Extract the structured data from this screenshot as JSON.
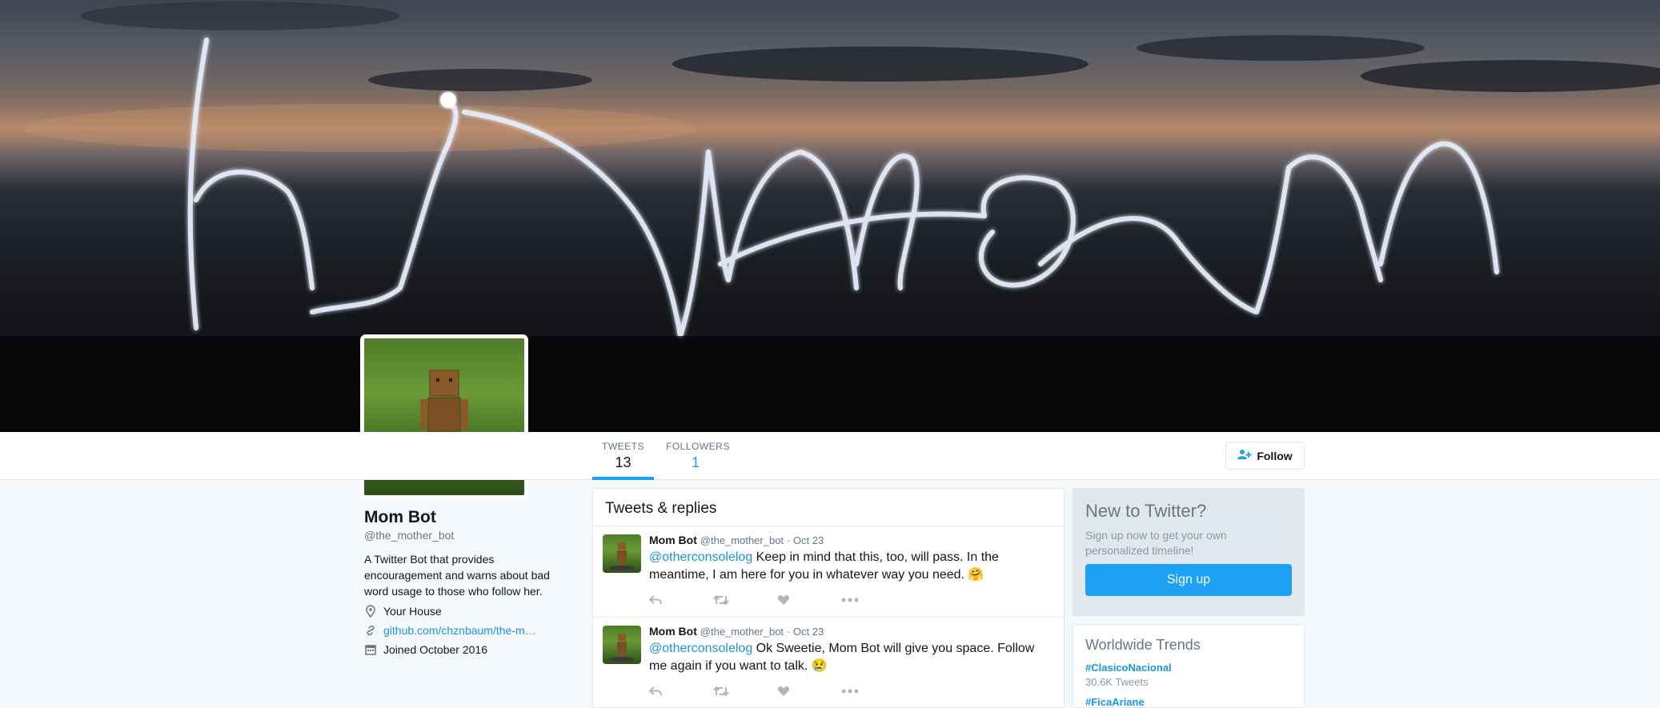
{
  "profile_nav": {
    "tweets_label": "TWEETS",
    "tweets_count": "13",
    "followers_label": "FOLLOWERS",
    "followers_count": "1",
    "follow_label": "Follow"
  },
  "profile": {
    "name": "Mom Bot",
    "handle": "@the_mother_bot",
    "bio": "A Twitter Bot that provides encouragement and warns about bad word usage to those who follow her.",
    "location": "Your House",
    "website": "github.com/chznbaum/the-m…",
    "joined": "Joined October 2016"
  },
  "timeline": {
    "header": "Tweets & replies",
    "tweets": [
      {
        "name": "Mom Bot",
        "handle": "@the_mother_bot",
        "date": "· Oct 23",
        "mention": "@otherconsolelog",
        "text": " Keep in mind that this, too, will pass. In the meantime, I am here for you in whatever way you need. 🤗"
      },
      {
        "name": "Mom Bot",
        "handle": "@the_mother_bot",
        "date": "· Oct 23",
        "mention": "@otherconsolelog",
        "text": " Ok Sweetie, Mom Bot will give you space. Follow me again if you want to talk. 😢"
      }
    ]
  },
  "signup": {
    "title": "New to Twitter?",
    "description": "Sign up now to get your own personalized timeline!",
    "button": "Sign up"
  },
  "trends": {
    "title": "Worldwide Trends",
    "items": [
      {
        "tag": "#ClasicoNacional",
        "count": "30.6K Tweets"
      },
      {
        "tag": "#FicaAriane",
        "count": ""
      }
    ]
  },
  "colors": {
    "accent": "#1da1f2",
    "link": "#1b95e0",
    "background": "#f5f8fa"
  },
  "icons": [
    "map-pin-icon",
    "link-icon",
    "calendar-icon",
    "add-user-icon",
    "reply-icon",
    "retweet-icon",
    "like-icon",
    "more-icon"
  ]
}
